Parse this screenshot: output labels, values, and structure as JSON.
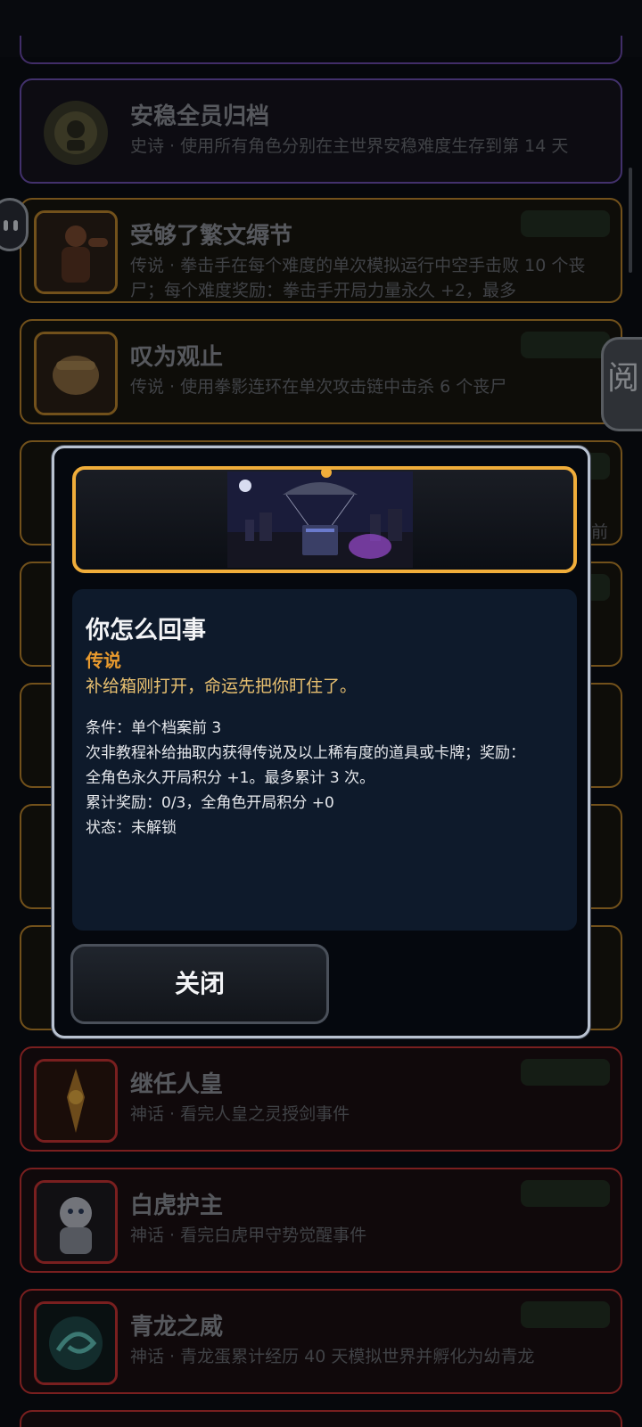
{
  "achievements": [
    {
      "title": "安稳全员归档",
      "desc": "史诗 · 使用所有角色分别在主世界安稳难度生存到第 14 天",
      "rarity": "epic"
    },
    {
      "title": "受够了繁文缛节",
      "desc": "传说 · 拳击手在每个难度的单次模拟运行中空手击败 10 个丧尸；每个难度奖励：拳击手开局力量永久 +2，最多",
      "rarity": "legend"
    },
    {
      "title": "叹为观止",
      "desc": "传说 · 使用拳影连环在单次攻击链中击杀 6 个丧尸",
      "rarity": "legend"
    },
    {
      "title": "继任人皇",
      "desc": "神话 · 看完人皇之灵授剑事件",
      "rarity": "myth"
    },
    {
      "title": "白虎护主",
      "desc": "神话 · 看完白虎甲守势觉醒事件",
      "rarity": "myth"
    },
    {
      "title": "青龙之威",
      "desc": "神话 · 青龙蛋累计经历 40 天模拟世界并孵化为幼青龙",
      "rarity": "myth"
    }
  ],
  "side_tab": {
    "glyph": "阅"
  },
  "partial_text": {
    "behind_right": "前"
  },
  "modal": {
    "title": "你怎么回事",
    "rarity": "传说",
    "flavor": "补给箱刚打开，命运先把你盯住了。",
    "details": [
      "条件：单个档案前 3",
      "次非教程补给抽取内获得传说及以上稀有度的道具或卡牌；奖励：",
      "全角色永久开局积分 +1。最多累计 3 次。",
      "累计奖励：0/3，全角色开局积分 +0",
      "状态：未解锁"
    ],
    "close_label": "关闭"
  },
  "colors": {
    "epic": "#6b4fae",
    "legend": "#b9842c",
    "myth": "#c43232",
    "modal_accent": "#f0ad3a"
  }
}
